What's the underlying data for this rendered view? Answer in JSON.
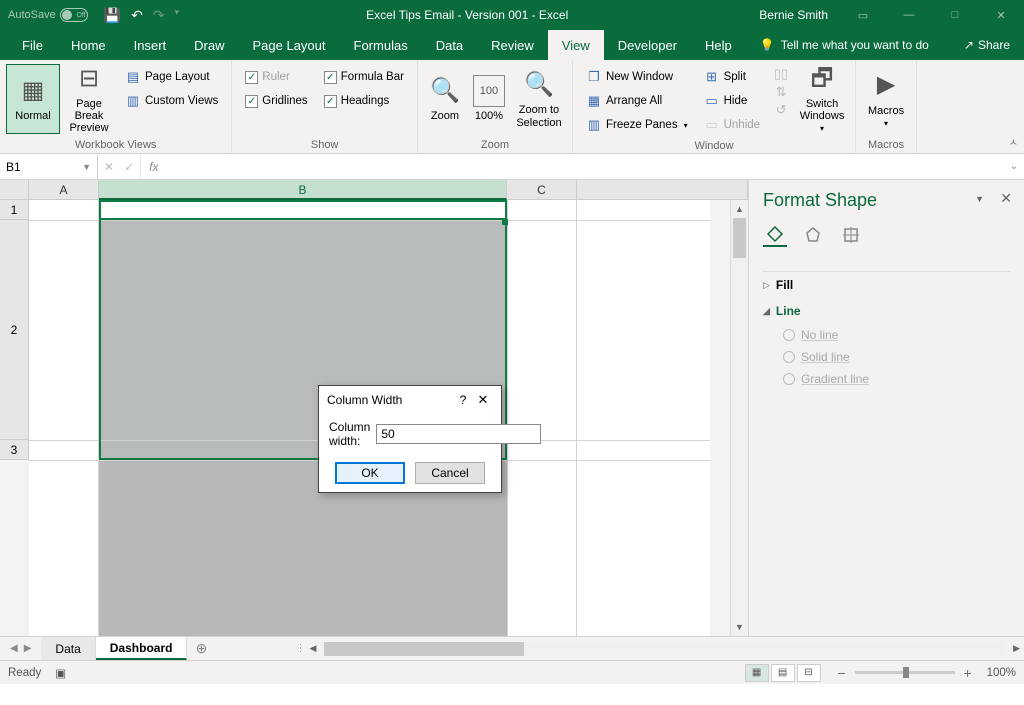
{
  "titlebar": {
    "autosave_label": "AutoSave",
    "autosave_state": "Off",
    "doc_title": "Excel Tips Email - Version 001  -  Excel",
    "user": "Bernie Smith"
  },
  "menu": {
    "tabs": [
      "File",
      "Home",
      "Insert",
      "Draw",
      "Page Layout",
      "Formulas",
      "Data",
      "Review",
      "View",
      "Developer",
      "Help"
    ],
    "active": "View",
    "tell_me": "Tell me what you want to do",
    "share": "Share"
  },
  "ribbon": {
    "groups": {
      "workbook_views": {
        "label": "Workbook Views",
        "normal": "Normal",
        "page_break": "Page Break\nPreview",
        "page_layout": "Page Layout",
        "custom_views": "Custom Views"
      },
      "show": {
        "label": "Show",
        "ruler": "Ruler",
        "gridlines": "Gridlines",
        "formula_bar": "Formula Bar",
        "headings": "Headings"
      },
      "zoom": {
        "label": "Zoom",
        "zoom": "Zoom",
        "hundred": "100%",
        "zoom_selection": "Zoom to\nSelection"
      },
      "window": {
        "label": "Window",
        "new_window": "New Window",
        "arrange_all": "Arrange All",
        "freeze_panes": "Freeze Panes",
        "split": "Split",
        "hide": "Hide",
        "unhide": "Unhide",
        "switch_windows": "Switch\nWindows"
      },
      "macros": {
        "label": "Macros",
        "macros": "Macros"
      }
    }
  },
  "namebox": "B1",
  "columns": [
    "A",
    "B",
    "C"
  ],
  "rows": [
    "1",
    "2",
    "3"
  ],
  "sheet_tabs": {
    "data": "Data",
    "dashboard": "Dashboard"
  },
  "pane": {
    "title": "Format Shape",
    "fill": "Fill",
    "line": "Line",
    "no_line": "No line",
    "solid_line": "Solid line",
    "gradient_line": "Gradient line"
  },
  "dialog": {
    "title": "Column Width",
    "label": "Column width:",
    "value": "50",
    "ok": "OK",
    "cancel": "Cancel"
  },
  "status": {
    "ready": "Ready",
    "zoom": "100%"
  }
}
